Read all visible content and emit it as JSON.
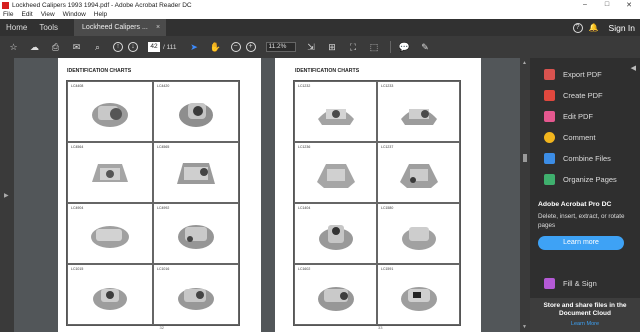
{
  "window": {
    "title": "Lockheed Calipers 1993 1994.pdf - Adobe Acrobat Reader DC",
    "buttons": {
      "minimize": "–",
      "maximize": "□",
      "close": "✕"
    }
  },
  "menu": [
    "File",
    "Edit",
    "View",
    "Window",
    "Help"
  ],
  "tabs": {
    "home": "Home",
    "tools": "Tools",
    "document": "Lockheed Calipers ...",
    "close": "×",
    "help": "?",
    "signin": "Sign In"
  },
  "toolbar": {
    "page_current": "42",
    "page_total": "/ 111",
    "zoom": "11.2%"
  },
  "pages": {
    "left": {
      "title": "IDENTIFICATION CHARTS",
      "cells": [
        "LC4408",
        "LC4420",
        "LC4564",
        "LC4565",
        "LC4904",
        "LC4992",
        "LC1015",
        "LC1016"
      ],
      "num": "32"
    },
    "right": {
      "title": "IDENTIFICATION CHARTS",
      "cells": [
        "LC1232",
        "LC1233",
        "LC1236",
        "LC1237",
        "LC1404",
        "LC1580",
        "LC1602",
        "LC1591"
      ],
      "num": "33"
    }
  },
  "right_panel": {
    "tools": [
      {
        "label": "Export PDF",
        "color": "#d9534f"
      },
      {
        "label": "Create PDF",
        "color": "#e0483e"
      },
      {
        "label": "Edit PDF",
        "color": "#e5588f"
      },
      {
        "label": "Comment",
        "color": "#f2b51d"
      },
      {
        "label": "Combine Files",
        "color": "#3c8de6"
      },
      {
        "label": "Organize Pages",
        "color": "#3fb06e"
      }
    ],
    "promo_title": "Adobe Acrobat Pro DC",
    "promo_desc": "Delete, insert, extract, or rotate pages",
    "learn_more": "Learn more",
    "fill_sign": "Fill & Sign",
    "store_text": "Store and share files in the Document Cloud",
    "store_link": "Learn More"
  }
}
